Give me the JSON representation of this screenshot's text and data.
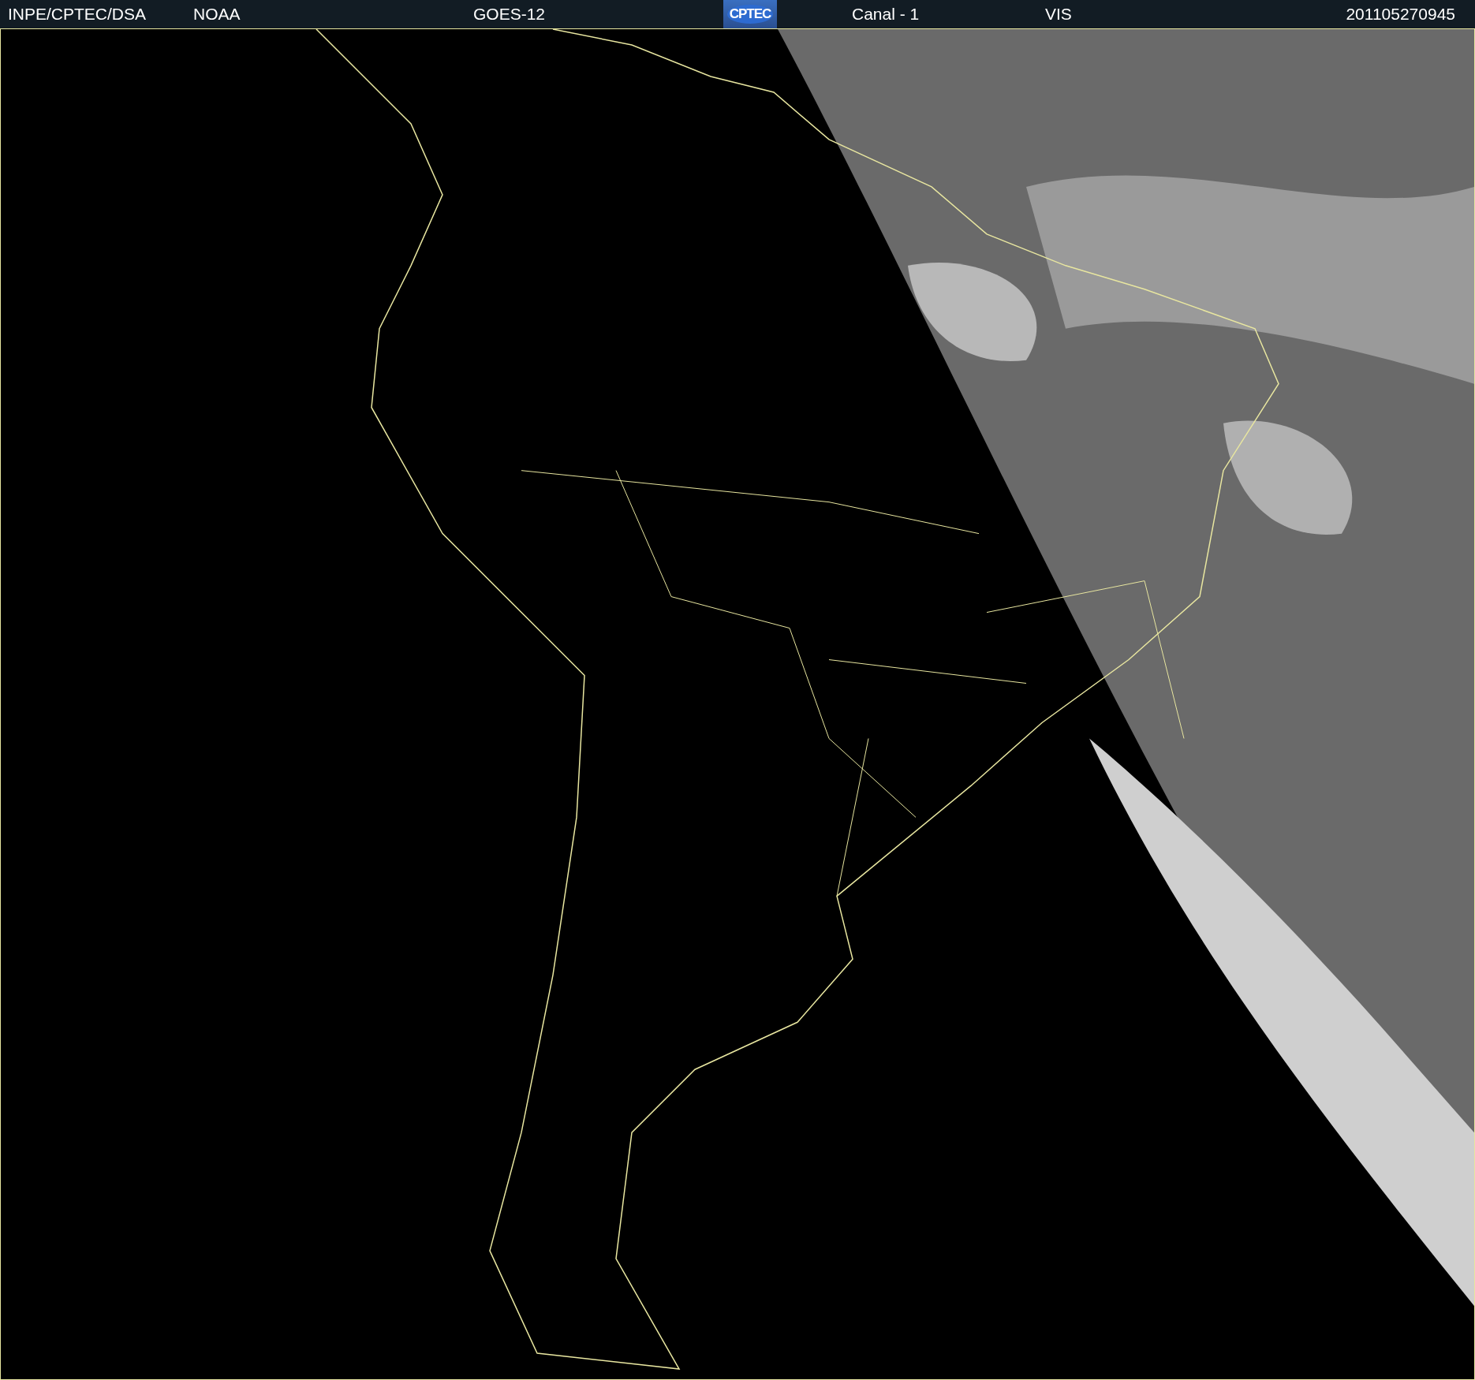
{
  "header": {
    "items": [
      {
        "kind": "text",
        "text": "INPE/CPTEC/DSA"
      },
      {
        "kind": "text",
        "text": "NOAA"
      },
      {
        "kind": "text",
        "text": "GOES-12"
      },
      {
        "kind": "logo",
        "text": "CPTEC"
      },
      {
        "kind": "text",
        "text": "Canal - 1"
      },
      {
        "kind": "text",
        "text": "VIS"
      },
      {
        "kind": "timestamp",
        "text": "201105270945"
      }
    ]
  }
}
